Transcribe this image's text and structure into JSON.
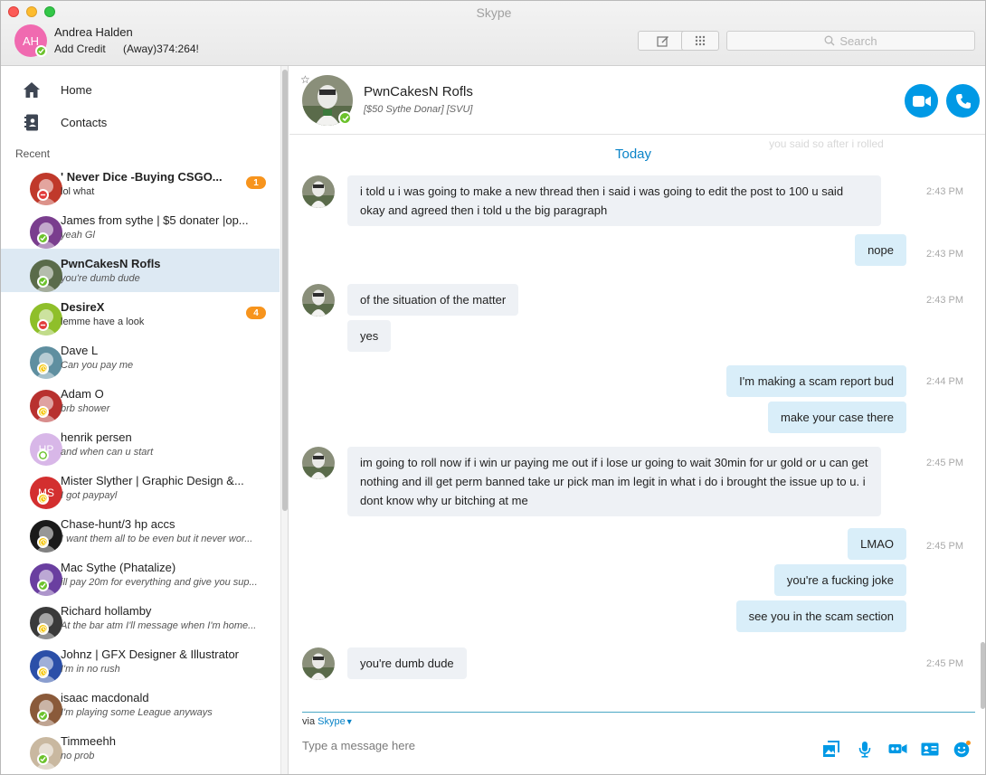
{
  "window": {
    "title": "Skype"
  },
  "me": {
    "initials": "AH",
    "name": "Andrea Halden",
    "credit_label": "Add Credit",
    "mood": "(Away)374:264!"
  },
  "search": {
    "placeholder": "Search"
  },
  "nav": {
    "home": "Home",
    "contacts": "Contacts",
    "recent": "Recent"
  },
  "contacts": [
    {
      "name": "' Never Dice -Buying CSGO...",
      "msg": "lol what",
      "bold": true,
      "italic": false,
      "status": "busy",
      "badge": "1",
      "color": "#c0392b"
    },
    {
      "name": "James from sythe | $5 donater |op...",
      "msg": "yeah Gl",
      "bold": false,
      "italic": true,
      "status": "online",
      "badge": "",
      "color": "#7a3e8e"
    },
    {
      "name": "PwnCakesN Rofls",
      "msg": "you're dumb dude",
      "bold": true,
      "italic": true,
      "status": "online",
      "badge": "",
      "color": "#5a6b4a",
      "selected": true
    },
    {
      "name": "DesireX",
      "msg": "lemme have a look",
      "bold": true,
      "italic": false,
      "status": "busy",
      "badge": "4",
      "color": "#8fbf2a"
    },
    {
      "name": "Dave L",
      "msg": "Can you pay me",
      "bold": false,
      "italic": true,
      "status": "away",
      "badge": "",
      "color": "#5f8fa0"
    },
    {
      "name": "Adam O",
      "msg": "brb shower",
      "bold": false,
      "italic": true,
      "status": "away",
      "badge": "",
      "color": "#b8312f"
    },
    {
      "name": "henrik persen",
      "msg": "and when can u start",
      "bold": false,
      "italic": true,
      "status": "offline",
      "badge": "",
      "color": "#d8b7e8",
      "initials": "HP"
    },
    {
      "name": "Mister Slyther | Graphic Design &...",
      "msg": "I got paypayl",
      "bold": false,
      "italic": true,
      "status": "away",
      "badge": "",
      "color": "#d32f2f",
      "initials": "MS"
    },
    {
      "name": "Chase-hunt/3 hp accs",
      "msg": "I want them all to be even but it never wor...",
      "bold": false,
      "italic": true,
      "status": "away",
      "badge": "",
      "color": "#1a1a1a"
    },
    {
      "name": "Mac Sythe (Phatalize)",
      "msg": "ill pay 20m for everything and give you sup...",
      "bold": false,
      "italic": true,
      "status": "online",
      "badge": "",
      "color": "#6a3fa0"
    },
    {
      "name": "Richard hollamby",
      "msg": "At the bar atm I'll message when I'm home...",
      "bold": false,
      "italic": true,
      "status": "away",
      "badge": "",
      "color": "#3a3a3a"
    },
    {
      "name": "Johnz | GFX Designer & Illustrator",
      "msg": "I'm in no rush",
      "bold": false,
      "italic": true,
      "status": "away",
      "badge": "",
      "color": "#2b4fa8"
    },
    {
      "name": "isaac macdonald",
      "msg": "I'm playing some League anyways",
      "bold": false,
      "italic": true,
      "status": "online",
      "badge": "",
      "color": "#8a5a3a"
    },
    {
      "name": "Timmeehh",
      "msg": "no prob",
      "bold": false,
      "italic": true,
      "status": "online",
      "badge": "",
      "color": "#c9b8a0"
    }
  ],
  "chat": {
    "name": "PwnCakesN Rofls",
    "subtitle": "[$50 Sythe Donar] [SVU]",
    "day": "Today",
    "ghost": "you said so after i rolled",
    "messages": [
      {
        "dir": "in",
        "text": "i told u i was going to make a new thread then i said i was going to edit the post to 100 u said okay and agreed then i told u the big paragraph",
        "time": "2:43 PM"
      },
      {
        "dir": "out",
        "text": "nope",
        "time": "2:43 PM"
      },
      {
        "dir": "in",
        "text": "of the situation of the matter",
        "time": "2:43 PM"
      },
      {
        "dir": "in",
        "text": "yes",
        "time": ""
      },
      {
        "dir": "out",
        "text": "I'm making a scam report bud",
        "time": "2:44 PM"
      },
      {
        "dir": "out",
        "text": "make your case there",
        "time": ""
      },
      {
        "dir": "in",
        "text": "im going to roll now if i win ur paying me out if i lose ur going to wait 30min for ur gold or u can get nothing and ill get perm banned take ur pick man im legit in what i do i brought the issue up to u. i dont know why ur bitching at me",
        "time": "2:45 PM"
      },
      {
        "dir": "out",
        "text": "LMAO",
        "time": "2:45 PM"
      },
      {
        "dir": "out",
        "text": "you're a fucking joke",
        "time": ""
      },
      {
        "dir": "out",
        "text": "see you in the scam section",
        "time": ""
      },
      {
        "dir": "in",
        "text": "you're dumb dude",
        "time": "2:45 PM"
      }
    ]
  },
  "compose": {
    "via_label": "via",
    "via_link": "Skype",
    "placeholder": "Type a message here"
  },
  "colors": {
    "accent": "#0099e5",
    "link": "#0a84c8",
    "bubble_in": "#eef1f5",
    "bubble_out": "#d9eef9",
    "badge": "#f7941d"
  }
}
